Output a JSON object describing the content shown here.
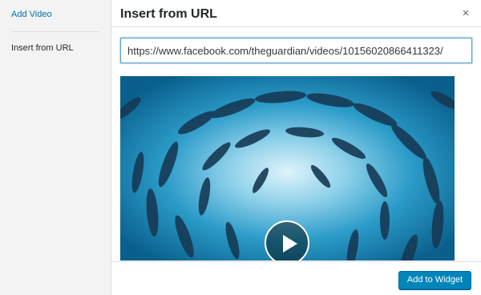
{
  "sidebar": {
    "items": [
      {
        "label": "Add Video"
      },
      {
        "label": "Insert from URL"
      }
    ]
  },
  "frame": {
    "title": "Insert from URL",
    "close_icon": "×",
    "url_value": "https://www.facebook.com/theguardian/videos/10156020866411323/"
  },
  "toolbar": {
    "add_label": "Add to Widget"
  },
  "colors": {
    "link": "#0073aa",
    "primary_button": "#0085ba",
    "video_water": "#0d6a9a"
  },
  "icons": {
    "close": "close-icon",
    "play": "play-icon"
  }
}
